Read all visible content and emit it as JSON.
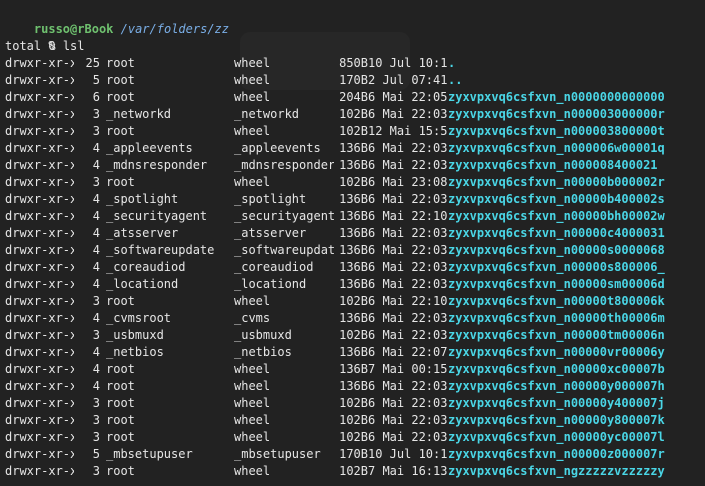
{
  "colors": {
    "background": "#222222",
    "text": "#e6e6e6",
    "prompt_green": "#6fc16f",
    "path_blue": "#7aaee6",
    "dir_cyan": "#4ad6e6"
  },
  "prompt": {
    "user": "russo",
    "at": "@",
    "host": "rBook",
    "path": "/var/folders/zz",
    "symbol": "  % ",
    "command": "lsl"
  },
  "total_line": "total 0",
  "listing": [
    {
      "perm": "drwxr-xr-x",
      "links": "25",
      "owner": "root",
      "group": "wheel",
      "size": "850B",
      "date": "10 Jul 10:11",
      "name": "."
    },
    {
      "perm": "drwxr-xr-x",
      "links": "5",
      "owner": "root",
      "group": "wheel",
      "size": "170B",
      "date": "2 Jul 07:41",
      "name": ".."
    },
    {
      "perm": "drwxr-xr-x",
      "links": "6",
      "owner": "root",
      "group": "wheel",
      "size": "204B",
      "date": "6 Mai 22:05",
      "name": "zyxvpxvq6csfxvn_n0000000000000"
    },
    {
      "perm": "drwxr-xr-x",
      "links": "3",
      "owner": "_networkd",
      "group": "_networkd",
      "size": "102B",
      "date": "6 Mai 22:03",
      "name": "zyxvpxvq6csfxvn_n000003000000r"
    },
    {
      "perm": "drwxr-xr-x",
      "links": "3",
      "owner": "root",
      "group": "wheel",
      "size": "102B",
      "date": "12 Mai 15:53",
      "name": "zyxvpxvq6csfxvn_n000003800000t"
    },
    {
      "perm": "drwxr-xr-x",
      "links": "4",
      "owner": "_appleevents",
      "group": "_appleevents",
      "size": "136B",
      "date": "6 Mai 22:03",
      "name": "zyxvpxvq6csfxvn_n000006w00001q"
    },
    {
      "perm": "drwxr-xr-x",
      "links": "4",
      "owner": "_mdnsresponder",
      "group": "_mdnsresponder",
      "size": "136B",
      "date": "6 Mai 22:03",
      "name": "zyxvpxvq6csfxvn_n000008400021"
    },
    {
      "perm": "drwxr-xr-x",
      "links": "3",
      "owner": "root",
      "group": "wheel",
      "size": "102B",
      "date": "6 Mai 23:08",
      "name": "zyxvpxvq6csfxvn_n00000b000002r"
    },
    {
      "perm": "drwxr-xr-x",
      "links": "4",
      "owner": "_spotlight",
      "group": "_spotlight",
      "size": "136B",
      "date": "6 Mai 22:03",
      "name": "zyxvpxvq6csfxvn_n00000b400002s"
    },
    {
      "perm": "drwxr-xr-x",
      "links": "4",
      "owner": "_securityagent",
      "group": "_securityagent",
      "size": "136B",
      "date": "6 Mai 22:10",
      "name": "zyxvpxvq6csfxvn_n00000bh00002w"
    },
    {
      "perm": "drwxr-xr-x",
      "links": "4",
      "owner": "_atsserver",
      "group": "_atsserver",
      "size": "136B",
      "date": "6 Mai 22:03",
      "name": "zyxvpxvq6csfxvn_n00000c4000031"
    },
    {
      "perm": "drwxr-xr-x",
      "links": "4",
      "owner": "_softwareupdate",
      "group": "_softwareupdate",
      "size": "136B",
      "date": "6 Mai 22:03",
      "name": "zyxvpxvq6csfxvn_n00000s0000068"
    },
    {
      "perm": "drwxr-xr-x",
      "links": "4",
      "owner": "_coreaudiod",
      "group": "_coreaudiod",
      "size": "136B",
      "date": "6 Mai 22:03",
      "name": "zyxvpxvq6csfxvn_n00000s800006_"
    },
    {
      "perm": "drwxr-xr-x",
      "links": "4",
      "owner": "_locationd",
      "group": "_locationd",
      "size": "136B",
      "date": "6 Mai 22:03",
      "name": "zyxvpxvq6csfxvn_n00000sm00006d"
    },
    {
      "perm": "drwxr-xr-x",
      "links": "3",
      "owner": "root",
      "group": "wheel",
      "size": "102B",
      "date": "6 Mai 22:10",
      "name": "zyxvpxvq6csfxvn_n00000t800006k"
    },
    {
      "perm": "drwxr-xr-x",
      "links": "4",
      "owner": "_cvmsroot",
      "group": "_cvms",
      "size": "136B",
      "date": "6 Mai 22:03",
      "name": "zyxvpxvq6csfxvn_n00000th00006m"
    },
    {
      "perm": "drwxr-xr-x",
      "links": "3",
      "owner": "_usbmuxd",
      "group": "_usbmuxd",
      "size": "102B",
      "date": "6 Mai 22:03",
      "name": "zyxvpxvq6csfxvn_n00000tm00006n"
    },
    {
      "perm": "drwxr-xr-x",
      "links": "4",
      "owner": "_netbios",
      "group": "_netbios",
      "size": "136B",
      "date": "6 Mai 22:07",
      "name": "zyxvpxvq6csfxvn_n00000vr00006y"
    },
    {
      "perm": "drwxr-xr-x",
      "links": "4",
      "owner": "root",
      "group": "wheel",
      "size": "136B",
      "date": "7 Mai 00:15",
      "name": "zyxvpxvq6csfxvn_n00000xc00007b"
    },
    {
      "perm": "drwxr-xr-x",
      "links": "4",
      "owner": "root",
      "group": "wheel",
      "size": "136B",
      "date": "6 Mai 22:03",
      "name": "zyxvpxvq6csfxvn_n00000y000007h"
    },
    {
      "perm": "drwxr-xr-x",
      "links": "3",
      "owner": "root",
      "group": "wheel",
      "size": "102B",
      "date": "6 Mai 22:03",
      "name": "zyxvpxvq6csfxvn_n00000y400007j"
    },
    {
      "perm": "drwxr-xr-x",
      "links": "3",
      "owner": "root",
      "group": "wheel",
      "size": "102B",
      "date": "6 Mai 22:03",
      "name": "zyxvpxvq6csfxvn_n00000y800007k"
    },
    {
      "perm": "drwxr-xr-x",
      "links": "3",
      "owner": "root",
      "group": "wheel",
      "size": "102B",
      "date": "6 Mai 22:03",
      "name": "zyxvpxvq6csfxvn_n00000yc00007l"
    },
    {
      "perm": "drwxr-xr-x",
      "links": "5",
      "owner": "_mbsetupuser",
      "group": "_mbsetupuser",
      "size": "170B",
      "date": "10 Jul 10:11",
      "name": "zyxvpxvq6csfxvn_n00000z000007r"
    },
    {
      "perm": "drwxr-xr-x",
      "links": "3",
      "owner": "root",
      "group": "wheel",
      "size": "102B",
      "date": "7 Mai 16:13",
      "name": "zyxvpxvq6csfxvn_ngzzzzzvzzzzzy"
    }
  ]
}
